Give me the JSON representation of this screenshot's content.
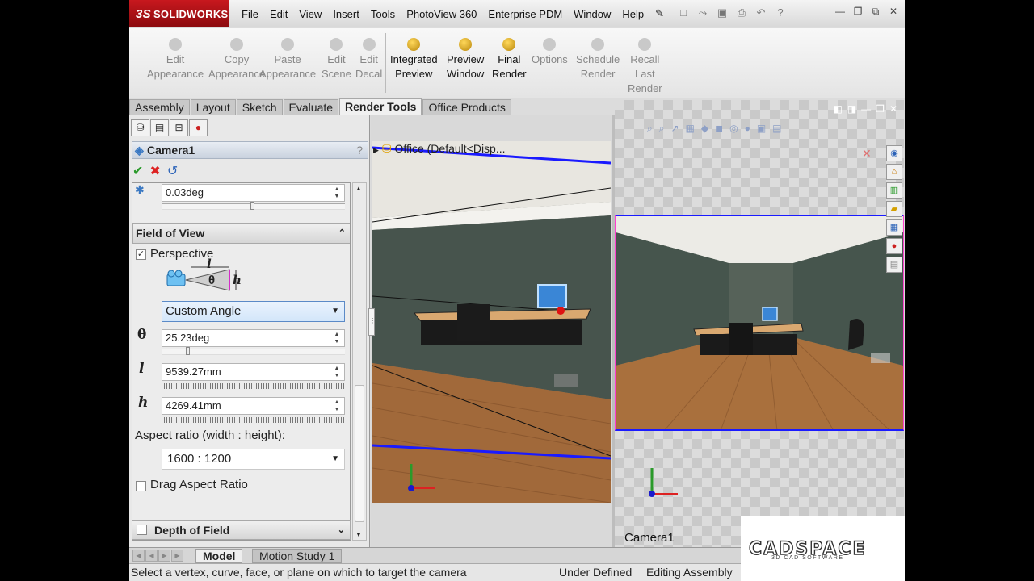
{
  "app": {
    "brand": "SOLIDWORKS",
    "brand_prefix": "3S"
  },
  "menu": [
    "File",
    "Edit",
    "View",
    "Insert",
    "Tools",
    "PhotoView 360",
    "Enterprise PDM",
    "Window",
    "Help"
  ],
  "ribbon": {
    "edit_appearance": [
      "Edit",
      "Appearance"
    ],
    "copy_appearance": [
      "Copy",
      "Appearance"
    ],
    "paste_appearance": [
      "Paste",
      "Appearance"
    ],
    "edit_scene": [
      "Edit",
      "Scene"
    ],
    "edit_decal": [
      "Edit",
      "Decal"
    ],
    "integrated_preview": [
      "Integrated",
      "Preview"
    ],
    "preview_window": [
      "Preview",
      "Window"
    ],
    "final_render": [
      "Final",
      "Render"
    ],
    "options": "Options",
    "schedule_render": [
      "Schedule",
      "Render"
    ],
    "recall_last_render": [
      "Recall",
      "Last",
      "Render"
    ]
  },
  "tabs": [
    "Assembly",
    "Layout",
    "Sketch",
    "Evaluate",
    "Render Tools",
    "Office Products"
  ],
  "active_tab": "Render Tools",
  "property_manager": {
    "title": "Camera1",
    "help": "?",
    "roll_value": "0.03deg",
    "fov_group": "Field of View",
    "perspective_label": "Perspective",
    "perspective_checked": true,
    "diagram": {
      "l": "l",
      "theta": "θ",
      "h": "h"
    },
    "fov_mode": "Custom Angle",
    "theta_symbol": "θ",
    "theta_value": "25.23deg",
    "l_symbol": "l",
    "l_value": "9539.27mm",
    "h_symbol": "h",
    "h_value": "4269.41mm",
    "aspect_label": "Aspect ratio (width : height):",
    "aspect_value": "1600 : 1200",
    "drag_aspect_label": "Drag Aspect Ratio",
    "drag_aspect_checked": false,
    "dof_group": "Depth of Field"
  },
  "viewport": {
    "tree_label": "Office  (Default<Disp..."
  },
  "preview": {
    "camera_label": "Camera1"
  },
  "bottom_tabs": [
    "Model",
    "Motion Study 1"
  ],
  "status": {
    "message": "Select a vertex, curve, face, or plane on which to target the camera",
    "state": "Under Defined",
    "mode": "Editing Assembly"
  },
  "watermark": {
    "name": "CADSPACE",
    "sub": "3D CAD SOFTWARE"
  },
  "colors": {
    "accent_blue": "#1a1aff",
    "brand_red": "#c8181e",
    "selection_blue": "#5b8ac7"
  }
}
